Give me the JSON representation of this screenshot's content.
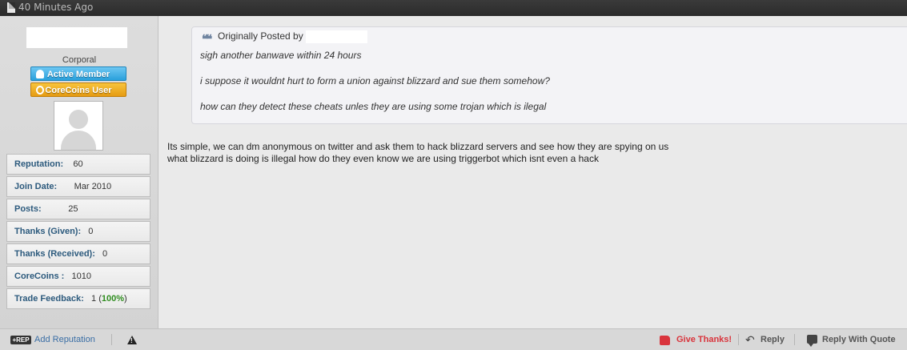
{
  "header": {
    "time_ago": "40 Minutes Ago"
  },
  "user": {
    "rank": "Corporal",
    "badges": [
      "Active Member",
      "CoreCoins User"
    ],
    "stats": [
      {
        "label": "Reputation:",
        "value": "60"
      },
      {
        "label": "Join Date:",
        "value": "Mar 2010"
      },
      {
        "label": "Posts:",
        "value": "25"
      },
      {
        "label": "Thanks (Given):",
        "value": "0"
      },
      {
        "label": "Thanks (Received):",
        "value": "0"
      },
      {
        "label": "CoreCoins :",
        "value": "1010"
      }
    ],
    "trade_feedback": {
      "label": "Trade Feedback:",
      "value": "1",
      "pct": "100%"
    }
  },
  "quote": {
    "header": "Originally Posted by",
    "lines": [
      "sigh another banwave within 24 hours",
      "i suppose it wouldnt hurt to form a union against blizzard and sue them somehow?",
      "how can they detect these cheats unles they are using some trojan which is ilegal"
    ]
  },
  "post": {
    "lines": [
      "Its simple, we can dm anonymous on twitter and ask them to hack blizzard servers and see how they are spying on us",
      "what blizzard is doing is illegal how do they even know we are using triggerbot which isnt even a hack"
    ]
  },
  "footer": {
    "rep_icon_text": "+REP",
    "add_reputation": "Add Reputation",
    "give_thanks": "Give Thanks!",
    "reply": "Reply",
    "reply_with_quote": "Reply With Quote"
  },
  "colors": {
    "link": "#3a6ea5",
    "thanks": "#d9343c",
    "stat_label": "#2c5a7d",
    "feedback_green": "#2f8d1f"
  },
  "icons": [
    "document-icon",
    "lightbulb-icon",
    "coin-icon",
    "avatar-icon",
    "quote-icon",
    "warning-icon",
    "thumbs-up-icon",
    "reply-arrow-icon",
    "speech-bubble-icon"
  ]
}
